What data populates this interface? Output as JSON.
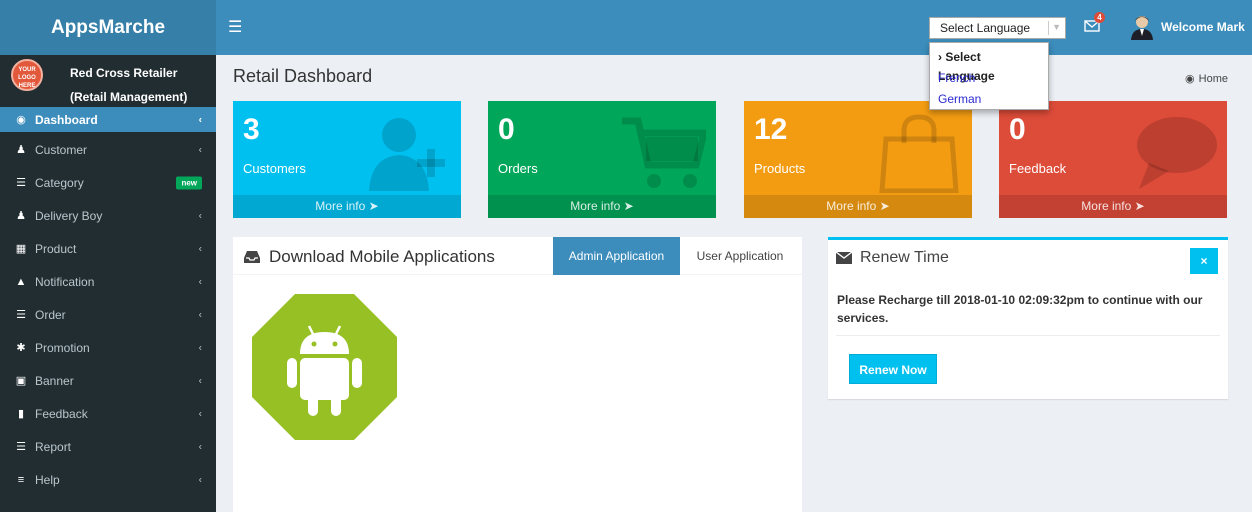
{
  "app": {
    "title": "AppsMarche"
  },
  "header": {
    "language_select_value": "Select Language",
    "mail_count": "4",
    "welcome_text": "Welcome Mark"
  },
  "language_dropdown": {
    "options": [
      "› Select Language",
      "French",
      "German"
    ]
  },
  "profile": {
    "logo_text": "YOUR LOGO HERE",
    "name": "Red Cross Retailer",
    "role": "(Retail Management)"
  },
  "sidebar": {
    "items": [
      {
        "label": "Dashboard",
        "icon": "dashboard-icon"
      },
      {
        "label": "Customer",
        "icon": "user-plus-icon"
      },
      {
        "label": "Category",
        "icon": "list-icon",
        "badge": "new"
      },
      {
        "label": "Delivery Boy",
        "icon": "user-icon"
      },
      {
        "label": "Product",
        "icon": "grid-icon"
      },
      {
        "label": "Notification",
        "icon": "warning-icon"
      },
      {
        "label": "Order",
        "icon": "list-icon"
      },
      {
        "label": "Promotion",
        "icon": "asterisk-icon"
      },
      {
        "label": "Banner",
        "icon": "image-icon"
      },
      {
        "label": "Feedback",
        "icon": "comment-icon"
      },
      {
        "label": "Report",
        "icon": "list-icon"
      },
      {
        "label": "Help",
        "icon": "bars-icon"
      }
    ]
  },
  "page": {
    "title": "Retail Dashboard",
    "breadcrumb": "Home"
  },
  "stats": [
    {
      "value": "3",
      "label": "Customers",
      "footer": "More info",
      "color": "#00c0ef",
      "icon": "user-plus-icon"
    },
    {
      "value": "0",
      "label": "Orders",
      "footer": "More info",
      "color": "#00a65a",
      "icon": "cart-icon"
    },
    {
      "value": "12",
      "label": "Products",
      "footer": "More info",
      "color": "#f39c12",
      "icon": "bag-icon"
    },
    {
      "value": "0",
      "label": "Feedback",
      "footer": "More info",
      "color": "#dd4b39",
      "icon": "comment-icon"
    }
  ],
  "download_box": {
    "title": "Download Mobile Applications",
    "tabs": [
      "Admin Application",
      "User Application"
    ],
    "active_tab": "Admin Application"
  },
  "renew_box": {
    "title": "Renew Time",
    "close_label": "×",
    "message": "Please Recharge till 2018-01-10 02:09:32pm to continue with our services.",
    "button_label": "Renew Now"
  },
  "colors": {
    "header": "#3c8dbc",
    "logo_bar": "#367fa9",
    "sidebar": "#222d32",
    "content_bg": "#ecf0f5",
    "android_green": "#97c024"
  }
}
